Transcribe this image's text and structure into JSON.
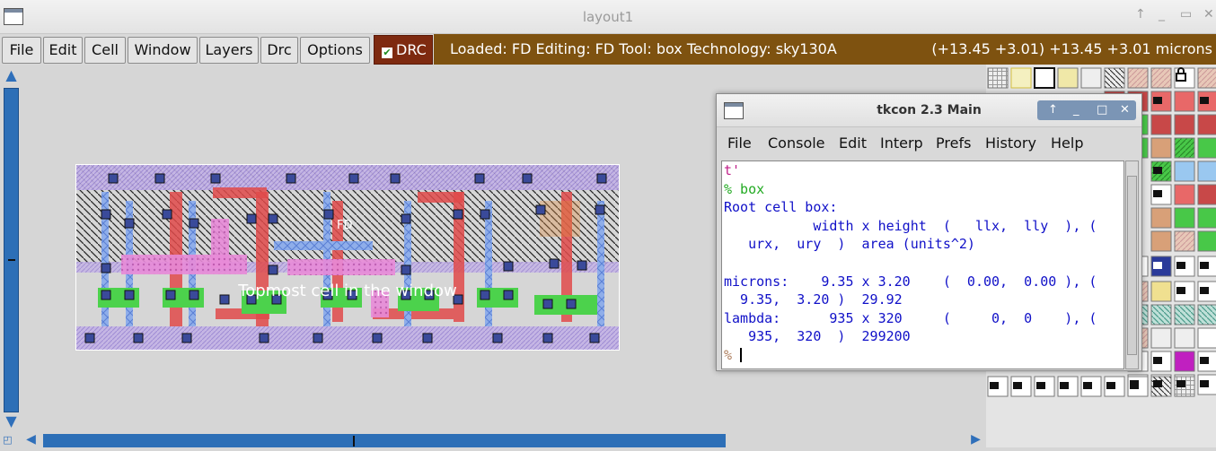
{
  "window": {
    "title": "layout1",
    "controls": [
      "↑",
      "_",
      "▭",
      "✕"
    ]
  },
  "menu": [
    "File",
    "Edit",
    "Cell",
    "Window",
    "Layers",
    "Drc",
    "Options"
  ],
  "drc": {
    "label": "DRC",
    "checked": true
  },
  "status": {
    "left": "Loaded: FD Editing: FD Tool: box  Technology: sky130A",
    "right": "(+13.45 +3.01) +13.45 +3.01 microns"
  },
  "canvas": {
    "cell_label": "Topmost cell in the window",
    "cell_tag": "FD"
  },
  "tkcon": {
    "title": "tkcon 2.3 Main",
    "controls": [
      "↑",
      "_",
      "□",
      "✕"
    ],
    "menu": [
      "File",
      "Console",
      "Edit",
      "Interp",
      "Prefs",
      "History",
      "Help"
    ],
    "lines": [
      {
        "text": "t'",
        "color": "#c0208a"
      },
      {
        "text": "% box",
        "color": "#22aa22"
      },
      {
        "text": "Root cell box:",
        "color": "#1010c8"
      },
      {
        "text": "           width x height  (   llx,  lly  ), (",
        "color": "#1010c8"
      },
      {
        "text": "   urx,  ury  )  area (units^2)",
        "color": "#1010c8"
      },
      {
        "text": "",
        "color": "#1010c8"
      },
      {
        "text": "microns:    9.35 x 3.20    (  0.00,  0.00 ), (",
        "color": "#1010c8"
      },
      {
        "text": "  9.35,  3.20 )  29.92",
        "color": "#1010c8"
      },
      {
        "text": "lambda:      935 x 320     (     0,  0    ), (",
        "color": "#1010c8"
      },
      {
        "text": "   935,  320  )  299200",
        "color": "#1010c8"
      }
    ],
    "prompt": "%"
  },
  "colors": {
    "status_bg": "#7e5210",
    "drc_bg": "#7e2a10",
    "scroll_thumb": "#2d6fb7",
    "tk_output": "#1010c8",
    "tk_command": "#22aa22"
  }
}
